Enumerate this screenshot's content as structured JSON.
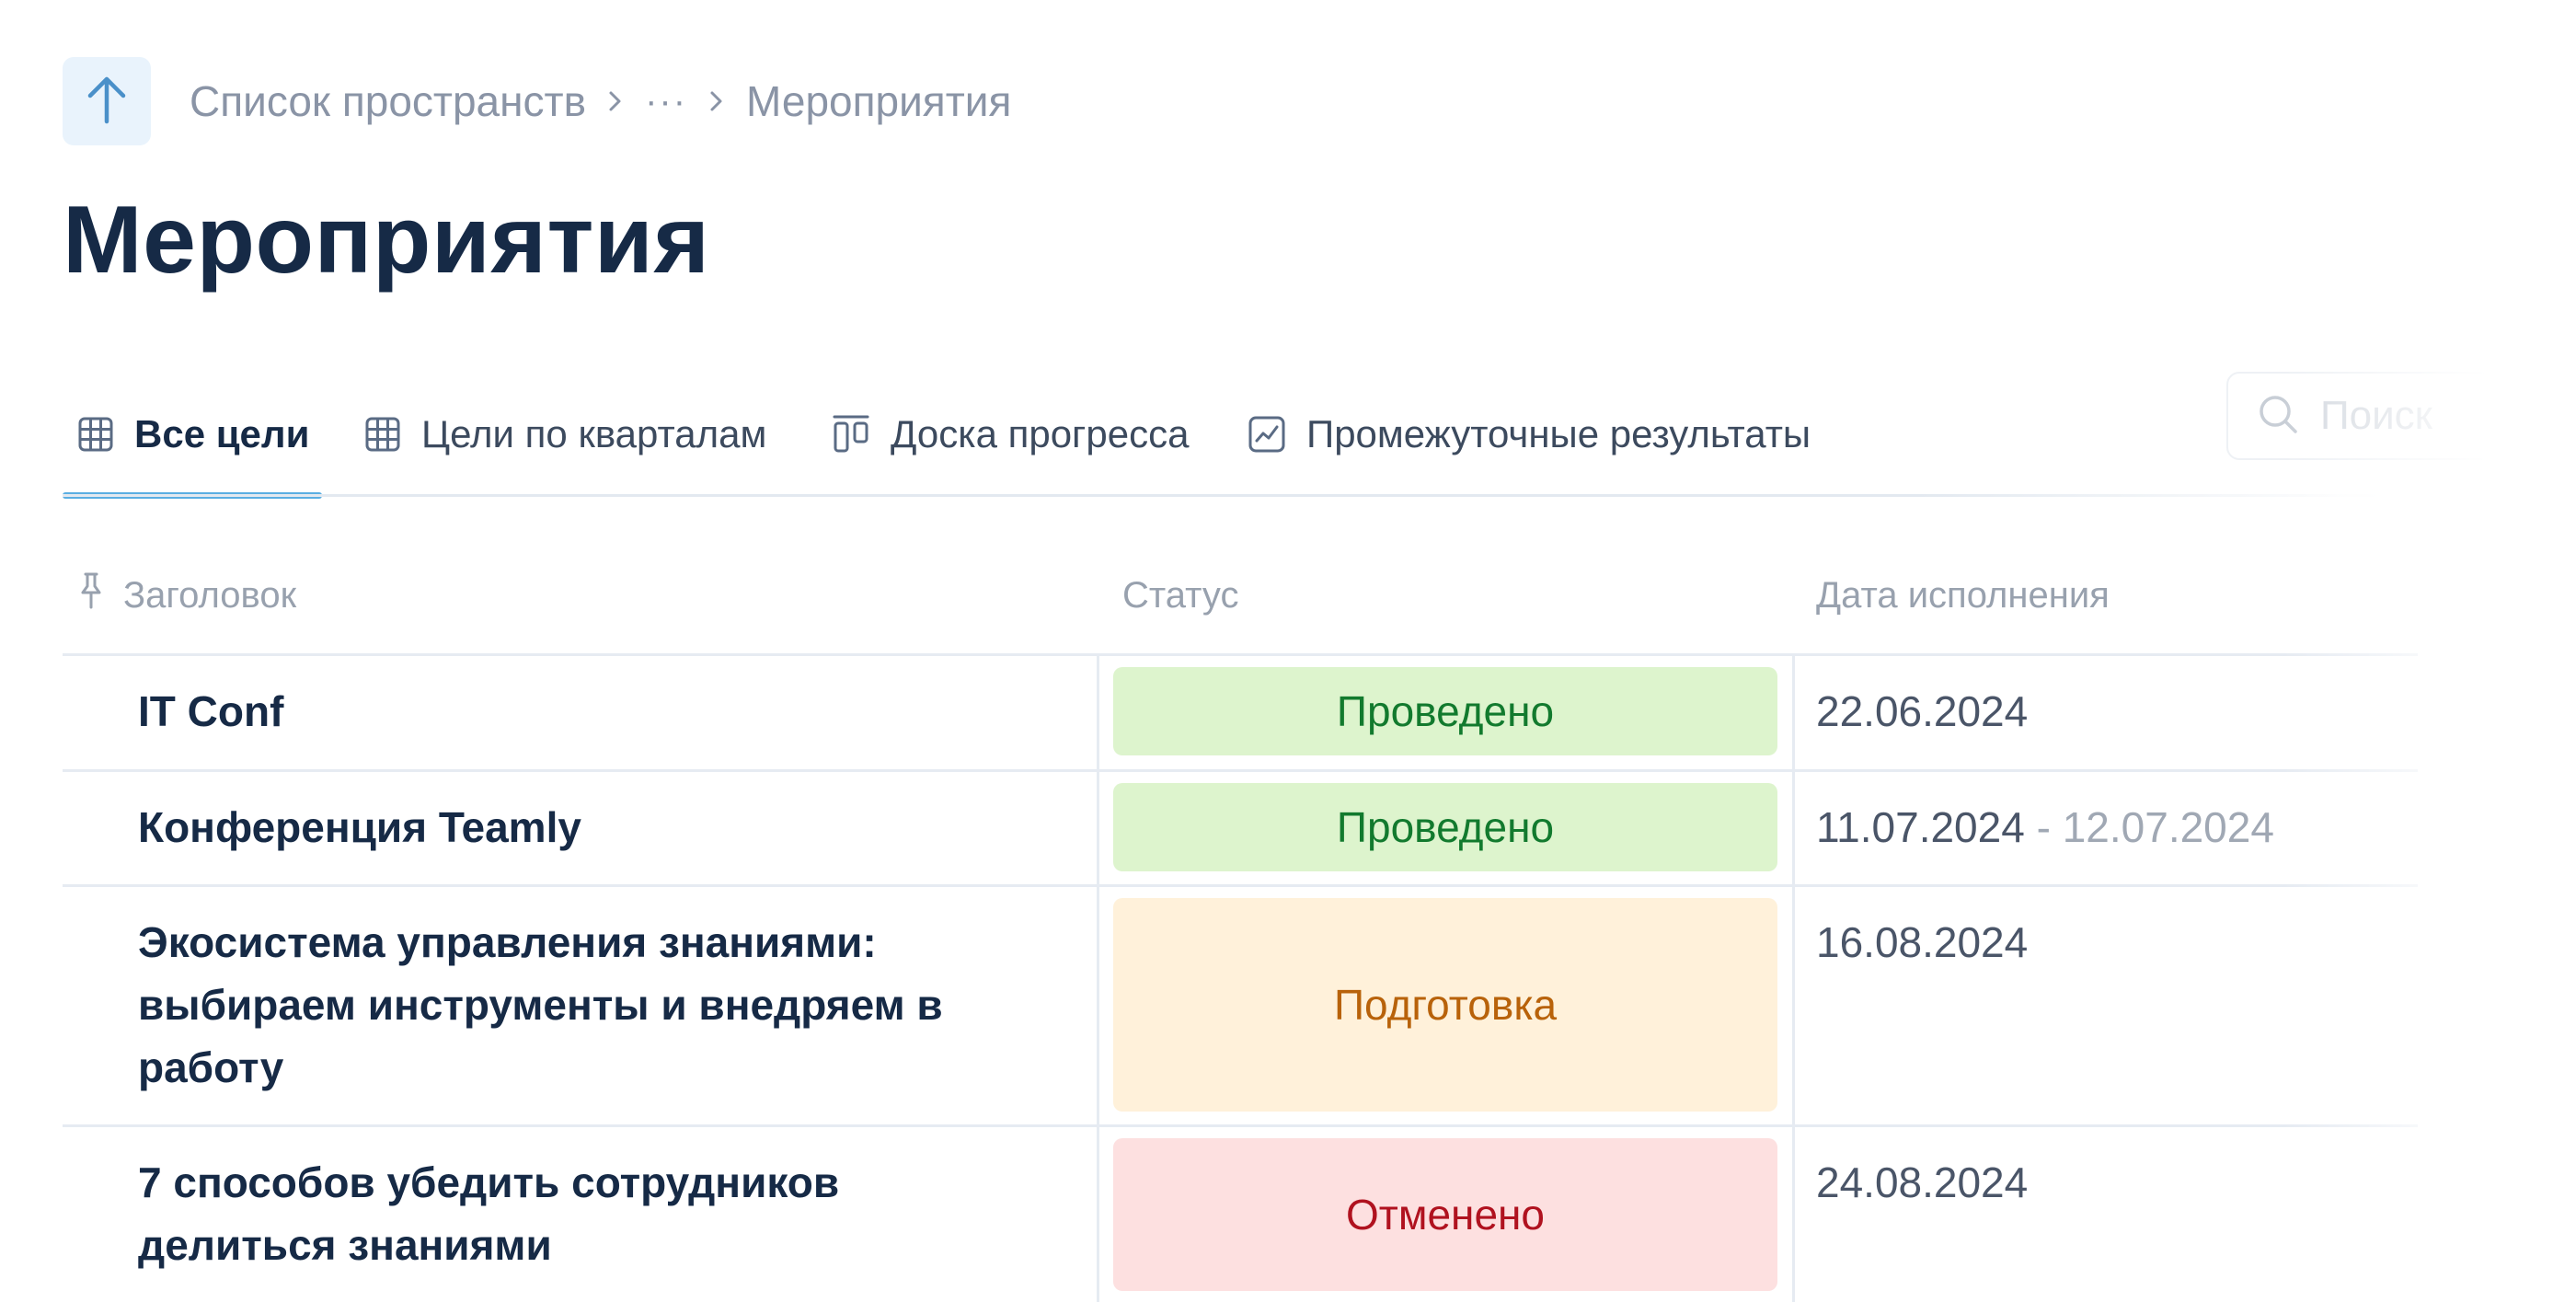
{
  "breadcrumb": {
    "items": [
      "Список пространств",
      "···",
      "Мероприятия"
    ]
  },
  "page": {
    "title": "Мероприятия"
  },
  "tabs": [
    {
      "label": "Все цели",
      "icon": "table-grid-icon",
      "active": true
    },
    {
      "label": "Цели по кварталам",
      "icon": "table-grid-icon",
      "active": false
    },
    {
      "label": "Доска прогресса",
      "icon": "kanban-board-icon",
      "active": false
    },
    {
      "label": "Промежуточные результаты",
      "icon": "line-chart-icon",
      "active": false
    }
  ],
  "search": {
    "placeholder": "Поиск"
  },
  "table": {
    "columns": [
      "Заголовок",
      "Статус",
      "Дата исполнения"
    ],
    "rows": [
      {
        "title": "IT Conf",
        "status": "Проведено",
        "date_start": "22.06.2024",
        "date_end": ""
      },
      {
        "title": "Конференция Teamly",
        "status": "Проведено",
        "date_start": "11.07.2024",
        "date_sep": " - ",
        "date_end": "12.07.2024"
      },
      {
        "title": "Экосистема управления знаниями: выбираем инструменты и внедряем в работу",
        "status": "Подготовка",
        "date_start": "16.08.2024",
        "date_end": ""
      },
      {
        "title": "7 способов убедить сотрудников делиться знаниями",
        "status": "Отменено",
        "date_start": "24.08.2024",
        "date_end": ""
      }
    ]
  },
  "colors": {
    "accent": "#5aaee2",
    "status_done_bg": "#ddf4cd",
    "status_prep_bg": "#fff1da",
    "status_cancel_bg": "#fde0e0"
  }
}
